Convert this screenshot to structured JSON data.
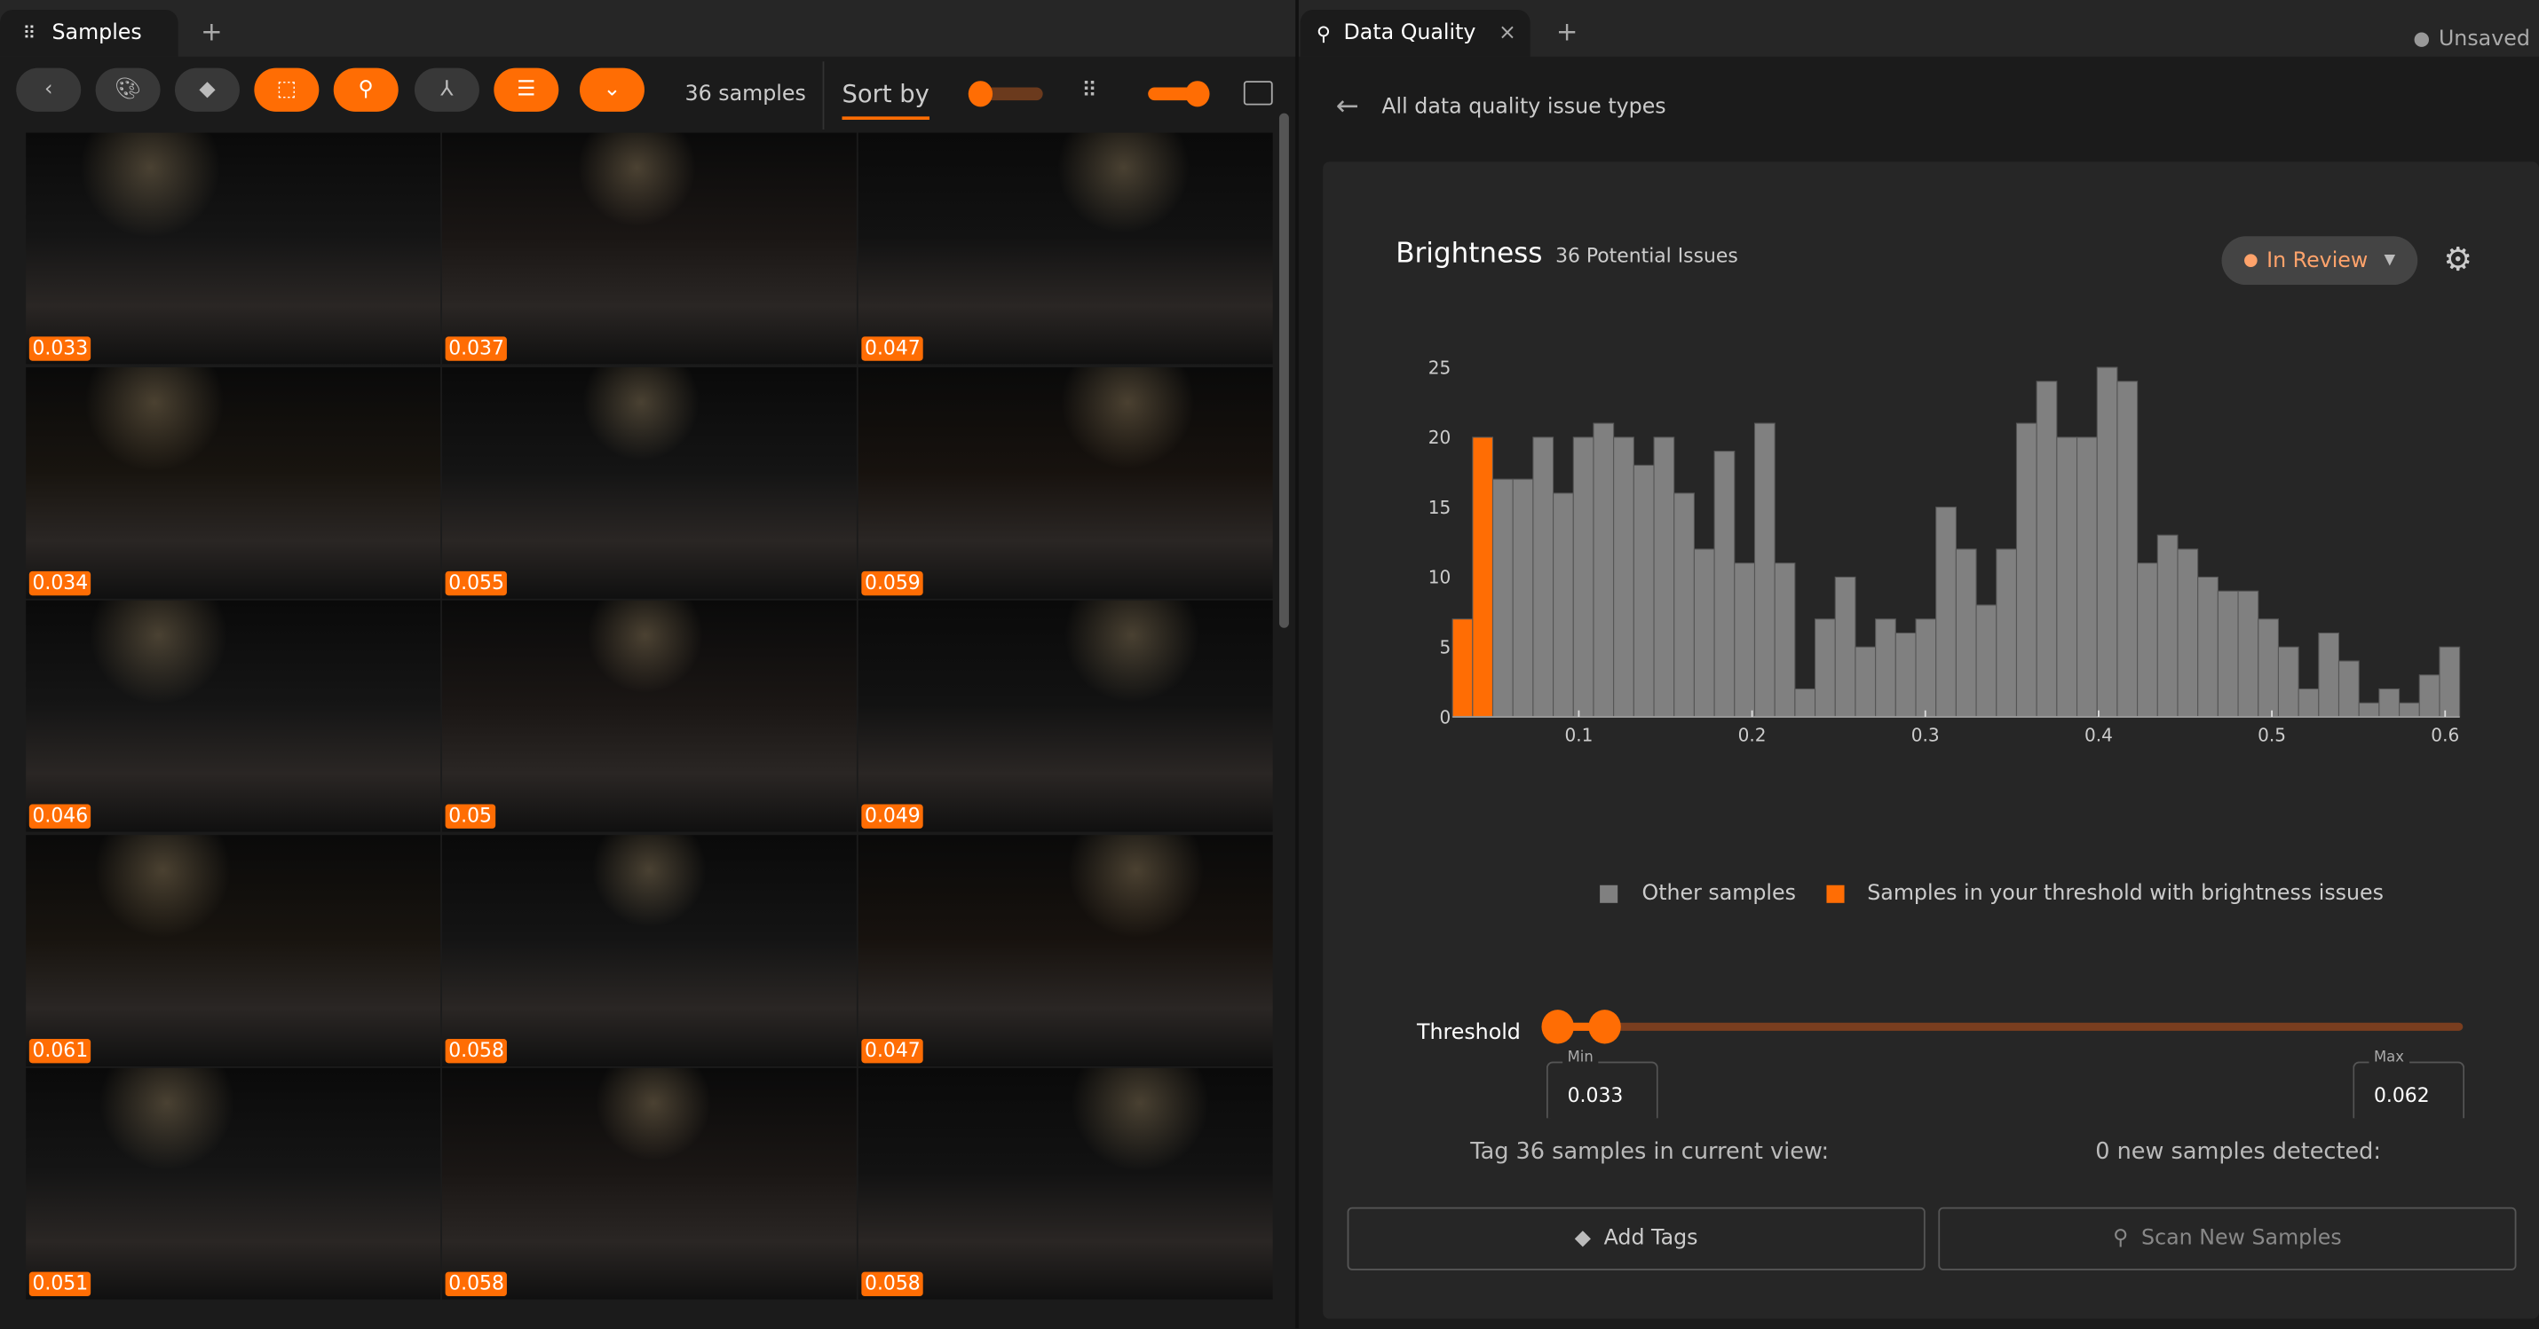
{
  "left_tabs": {
    "samples_label": "Samples",
    "add": "+"
  },
  "toolbar": {
    "sample_count": "36 samples",
    "sort_label": "Sort by",
    "icons": [
      "chevron-left",
      "palette",
      "tag",
      "selection",
      "search",
      "merge",
      "list",
      "chevron-down",
      "grid",
      "toggle",
      "display"
    ]
  },
  "samples": [
    {
      "value": "0.033"
    },
    {
      "value": "0.037"
    },
    {
      "value": "0.047"
    },
    {
      "value": "0.034"
    },
    {
      "value": "0.055"
    },
    {
      "value": "0.059"
    },
    {
      "value": "0.046"
    },
    {
      "value": "0.05"
    },
    {
      "value": "0.049"
    },
    {
      "value": "0.061"
    },
    {
      "value": "0.058"
    },
    {
      "value": "0.047"
    },
    {
      "value": "0.051"
    },
    {
      "value": "0.058"
    },
    {
      "value": "0.058"
    }
  ],
  "right_tabs": {
    "data_quality_label": "Data Quality",
    "close": "×",
    "add": "+",
    "status": "Unsaved"
  },
  "nav": {
    "back_label": "All data quality issue types"
  },
  "issue": {
    "title": "Brightness",
    "count_label": "36 Potential Issues",
    "status": "In Review"
  },
  "colors": {
    "accent": "#ff6d04",
    "other": "#808080",
    "background": "#262626"
  },
  "chart_data": {
    "type": "bar",
    "title": "Brightness",
    "xlabel": "",
    "ylabel": "",
    "x_range": [
      0.0271,
      0.6084
    ],
    "bin_width": 0.011626,
    "ylim": [
      0,
      25
    ],
    "yticks": [
      "0",
      "5",
      "10",
      "15",
      "20",
      "25"
    ],
    "xticks": [
      "0.1",
      "0.2",
      "0.3",
      "0.4",
      "0.5",
      "0.6"
    ],
    "values": [
      7,
      20,
      17,
      17,
      20,
      16,
      20,
      21,
      20,
      18,
      20,
      16,
      12,
      19,
      11,
      21,
      11,
      2,
      7,
      10,
      5,
      7,
      6,
      7,
      15,
      12,
      8,
      12,
      21,
      24,
      20,
      20,
      25,
      24,
      11,
      13,
      12,
      10,
      9,
      9,
      7,
      5,
      2,
      6,
      4,
      1,
      2,
      1,
      3,
      5
    ],
    "highlighted_bins": [
      0,
      1
    ],
    "legend": [
      {
        "name": "Other samples",
        "color": "#808080"
      },
      {
        "name": "Samples in your threshold with brightness issues",
        "color": "#ff6d04"
      }
    ],
    "legend_position": "bottom"
  },
  "threshold": {
    "label": "Threshold",
    "min_label": "Min",
    "max_label": "Max",
    "min": "0.033",
    "max": "0.062",
    "range": [
      0.033,
      0.6
    ]
  },
  "actions": {
    "tag_text": "Tag 36 samples in current view:",
    "scan_text": "0 new samples detected:",
    "add_tags": "Add Tags",
    "scan_new": "Scan New Samples"
  }
}
